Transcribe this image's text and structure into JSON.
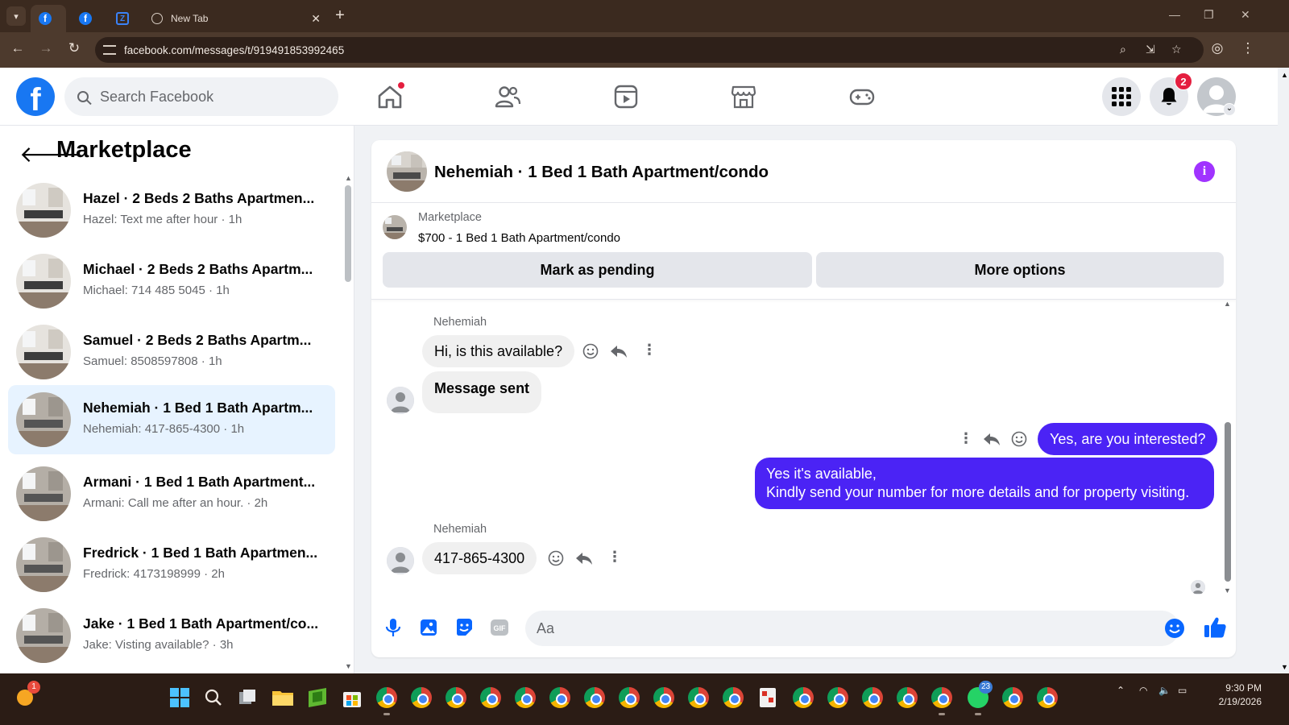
{
  "browser": {
    "tabs": [
      {
        "title": "",
        "favicon": "facebook-icon"
      },
      {
        "title": "",
        "favicon": "facebook-icon"
      },
      {
        "title": "",
        "favicon": "zillow-icon"
      },
      {
        "title": "New Tab",
        "favicon": "globe-icon"
      }
    ],
    "url": "facebook.com/messages/t/919491853992465"
  },
  "header": {
    "search_placeholder": "Search Facebook",
    "notification_count": "2"
  },
  "sidebar": {
    "title": "Marketplace",
    "conversations": [
      {
        "name": "Hazel · 2 Beds 2 Baths Apartmen...",
        "preview": "Hazel: Text me after hour · 1h"
      },
      {
        "name": "Michael · 2 Beds 2 Baths Apartm...",
        "preview": "Michael: 714 485 5045 · 1h"
      },
      {
        "name": "Samuel · 2 Beds 2 Baths Apartm...",
        "preview": "Samuel: 8508597808 · 1h"
      },
      {
        "name": "Nehemiah · 1 Bed 1 Bath Apartm...",
        "preview": "Nehemiah: 417-865-4300 · 1h"
      },
      {
        "name": "Armani · 1 Bed 1 Bath Apartment...",
        "preview": "Armani: Call me after an hour. · 2h"
      },
      {
        "name": "Fredrick · 1 Bed 1 Bath Apartmen...",
        "preview": "Fredrick: 4173198999 · 2h"
      },
      {
        "name": "Jake · 1 Bed 1 Bath Apartment/co...",
        "preview": "Jake: Visting available? · 3h"
      }
    ]
  },
  "chat": {
    "title": "Nehemiah · 1 Bed 1 Bath Apartment/condo",
    "listing_label": "Marketplace",
    "listing_title": "$700 - 1 Bed 1 Bath Apartment/condo",
    "mark_pending_label": "Mark as pending",
    "more_options_label": "More options",
    "messages": [
      {
        "author": "Nehemiah",
        "text": "Hi, is this available?"
      },
      {
        "text": "Message sent"
      },
      {
        "text": "Yes, are you interested?"
      },
      {
        "text_line1": "Yes it's available,",
        "text_line2": "Kindly send your number for more details and for property visiting."
      },
      {
        "author": "Nehemiah",
        "text": "417-865-4300"
      }
    ],
    "composer_placeholder": "Aa"
  },
  "taskbar": {
    "clock_time": "9:30 PM",
    "clock_date": "2/19/2026",
    "weather_badge": "1",
    "whatsapp_badge": "23"
  },
  "colors": {
    "fb_blue": "#1877f2",
    "outgoing_bubble": "#4b23f5",
    "active_conversation": "#e7f3ff",
    "info_purple": "#a033ff"
  }
}
